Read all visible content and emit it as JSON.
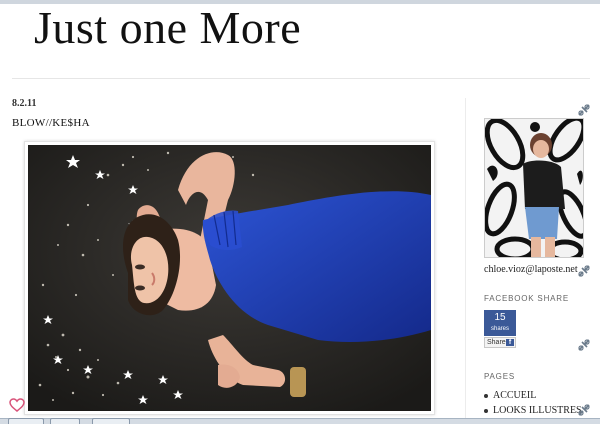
{
  "blog": {
    "title": "Just one More"
  },
  "post": {
    "date": "8.2.11",
    "title": "BLOW//KE$HA"
  },
  "sidebar": {
    "profile": {
      "email": "chloe.vioz@laposte.net"
    },
    "facebook_share": {
      "heading": "FACEBOOK SHARE",
      "count": "15",
      "unit": "shares",
      "button_label": "Share"
    },
    "pages": {
      "heading": "PAGES",
      "links": [
        "ACCUEIL",
        "LOOKS ILLUSTRES"
      ]
    }
  },
  "icons": {
    "like": "heart-icon",
    "edit": "edit-tool-icon",
    "facebook": "facebook-icon"
  },
  "colors": {
    "facebook_blue": "#3b5998",
    "dress_blue": "#1c3fb0",
    "like_heart": "#d9537a"
  }
}
